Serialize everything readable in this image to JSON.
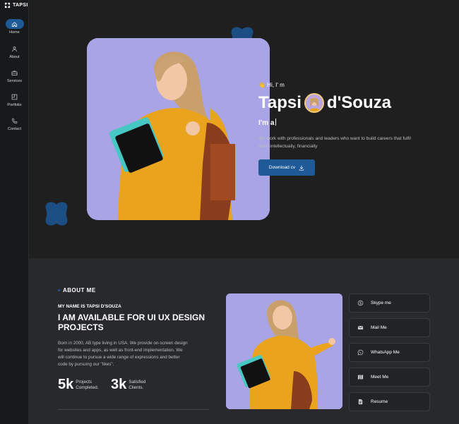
{
  "brand": {
    "name": "TAPSI"
  },
  "sidebar": {
    "items": [
      {
        "label": "Home",
        "icon": "home-icon",
        "active": true
      },
      {
        "label": "About",
        "icon": "user-icon",
        "active": false
      },
      {
        "label": "Services",
        "icon": "briefcase-icon",
        "active": false
      },
      {
        "label": "Portfolio",
        "icon": "portfolio-icon",
        "active": false
      },
      {
        "label": "Contact",
        "icon": "phone-icon",
        "active": false
      }
    ]
  },
  "hero": {
    "greeting": "👋 Hi, I' m",
    "name_first": "Tapsi",
    "name_last": "d'Souza",
    "typing_prefix": "I'm a",
    "description": "We work with professionals and leaders who want to build careers that fulfil them intellectually, financially",
    "download_label": "Download cv"
  },
  "about": {
    "tag": "ABOUT ME",
    "subtitle": "MY NAME IS TAPSI D'SOUZA",
    "headline": "I AM AVAILABLE FOR UI UX DESIGN PROJECTS",
    "text": "Born in 2000, AB type living in USA. We provide on-screen design for websites and apps, as well as front-end implementation. We will continue to pursue a wide range of expressions and better code by pursuing our \"likes\".",
    "stats": [
      {
        "value": "5k",
        "caption_1": "Projects",
        "caption_2": "Completed."
      },
      {
        "value": "3k",
        "caption_1": "Satisfied",
        "caption_2": "Clients."
      }
    ],
    "contacts": [
      {
        "label": "Skype me",
        "icon": "skype-icon"
      },
      {
        "label": "Mail Me",
        "icon": "mail-icon"
      },
      {
        "label": "WhatsApp Me",
        "icon": "whatsapp-icon"
      },
      {
        "label": "Meet Me",
        "icon": "map-icon"
      },
      {
        "label": "Resume",
        "icon": "document-icon"
      }
    ]
  },
  "colors": {
    "accent": "#1d5a96",
    "background": "#1f1f20",
    "section": "#28292c",
    "photo_bg": "#a9a4e6"
  }
}
